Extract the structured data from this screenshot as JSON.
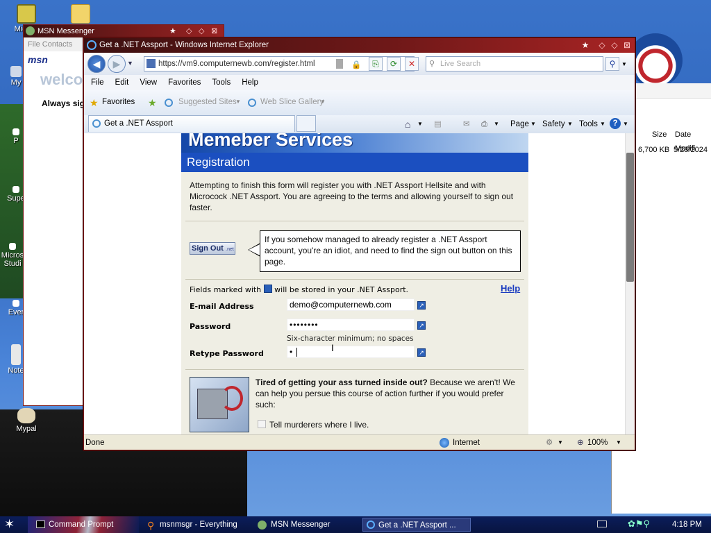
{
  "desktop": {
    "icons": [
      {
        "label": "Mic\nOu",
        "icon": "outlook-icon"
      },
      {
        "label": "",
        "icon": "folder-icon"
      },
      {
        "label": "My",
        "icon": "computer-icon"
      },
      {
        "label": "P",
        "icon": "shortcut-icon"
      },
      {
        "label": "Supe",
        "icon": "shortcut-icon"
      },
      {
        "label": "Micros\nStudi",
        "icon": "shortcut-icon"
      },
      {
        "label": "Ever",
        "icon": "shortcut-icon"
      },
      {
        "label": "Note",
        "icon": "notepad-icon"
      },
      {
        "label": "Mypal",
        "icon": "mypal-icon"
      }
    ]
  },
  "msn_window": {
    "title": "MSN Messenger",
    "menu": "File   Contacts",
    "logo": "msn",
    "welcome": "welco",
    "always_sign": "Always sig"
  },
  "explorer_window": {
    "columns": [
      "Size",
      "Date Modifi"
    ],
    "row": {
      "size": "6,700 KB",
      "date": "5/28/2024"
    }
  },
  "ie": {
    "title": "Get a .NET Assport - Windows Internet Explorer",
    "address": "https://vm9.computernewb.com/register.html",
    "search_placeholder": "Live Search",
    "menu": [
      "File",
      "Edit",
      "View",
      "Favorites",
      "Tools",
      "Help"
    ],
    "favorites_label": "Favorites",
    "suggested_sites": "Suggested Sites",
    "web_slice_gallery": "Web Slice Gallery",
    "tab_title": "Get a .NET Assport",
    "commands": {
      "page": "Page",
      "safety": "Safety",
      "tools": "Tools"
    },
    "status": {
      "text": "Done",
      "zone": "Internet",
      "zoom": "100%"
    }
  },
  "page": {
    "banner": "Memeber Services",
    "heading": "Registration",
    "intro": "Attempting to finish this form will register you with .NET Assport Hellsite and with Microcock .NET Assport. You are agreeing to the terms and allowing yourself to sign out faster.",
    "signout_button": "Sign Out",
    "signout_button_sub": ".net",
    "callout": "If you somehow managed to already register a .NET Assport account, you're an idiot, and need to find the sign out button on this page.",
    "fields_note_prefix": "Fields marked with",
    "fields_note_suffix": "will be stored in your .NET Assport.",
    "help_link": "Help",
    "email_label": "E-mail Address",
    "email_value": "demo@computernewb.com",
    "password_label": "Password",
    "password_value": "••••••••",
    "password_hint": "Six-character minimum; no spaces",
    "retype_label": "Retype Password",
    "retype_value": "•",
    "promo_bold": "Tired of getting your ass turned inside out?",
    "promo_text": " Because we aren't! We can help you persue this course of action further if you would prefer such:",
    "checkbox_label": "Tell murderers where I live."
  },
  "taskbar": {
    "items": [
      {
        "label": "Command Prompt",
        "icon": "cmd-icon"
      },
      {
        "label": "msnmsgr - Everything",
        "icon": "search-icon"
      },
      {
        "label": "MSN Messenger",
        "icon": "messenger-icon"
      },
      {
        "label": "Get a .NET Assport ...",
        "icon": "ie-icon"
      }
    ],
    "clock": "4:18 PM"
  },
  "colors": {
    "titlebar": "#6e1818",
    "reg_header": "#1b4fc0",
    "page_bg": "#efeee4",
    "taskbar": "#0b1d5a",
    "help_link": "#1a3bc0"
  }
}
